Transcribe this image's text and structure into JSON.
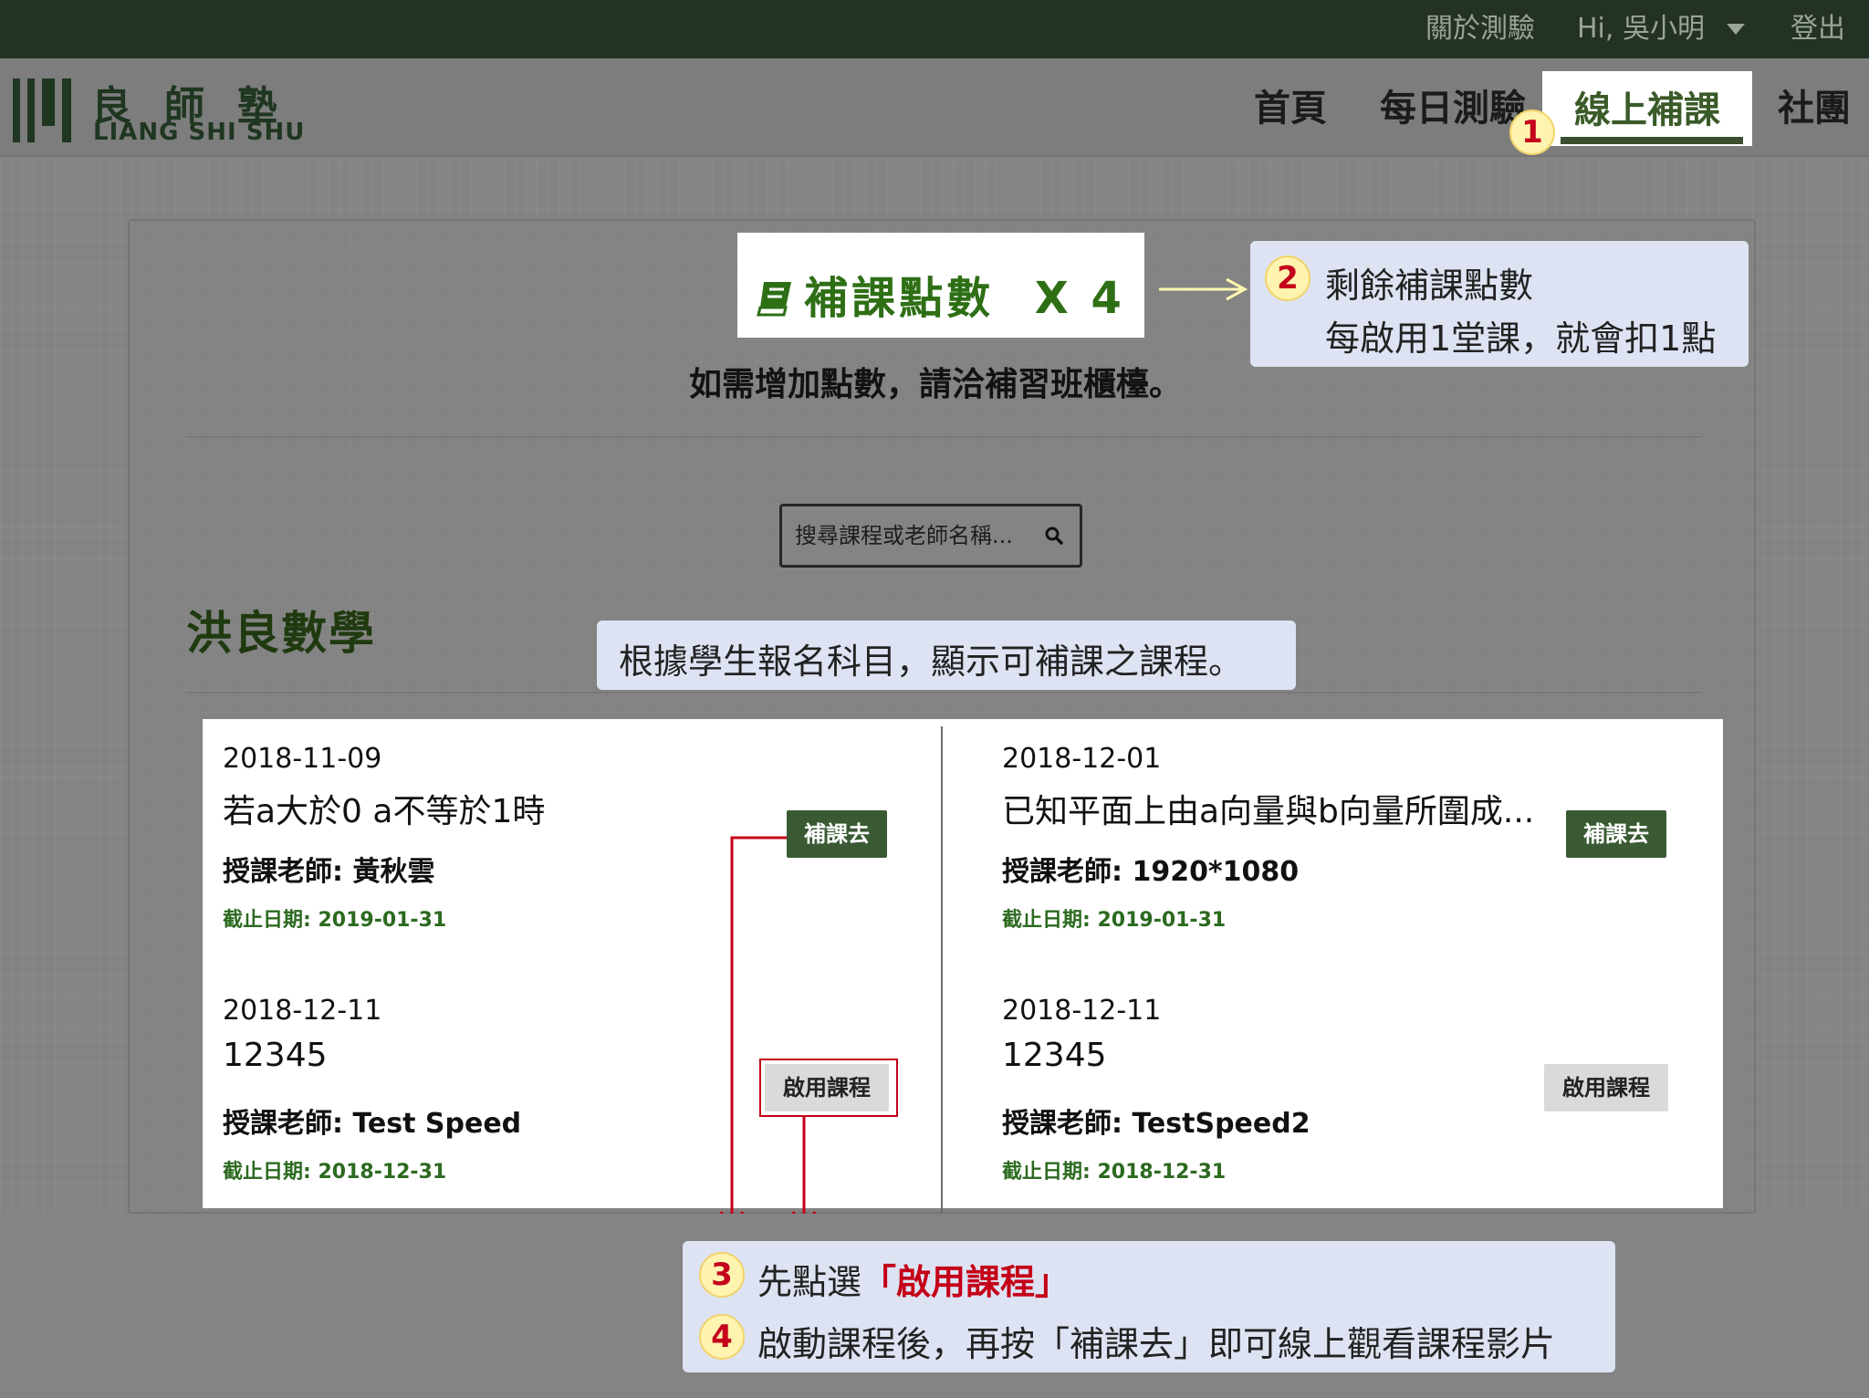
{
  "topbar": {
    "about": "關於測驗",
    "greeting": "Hi, 吳小明",
    "logout": "登出"
  },
  "logo": {
    "cn": "良師塾",
    "en": "LIANG SHI SHU"
  },
  "nav": {
    "home": "首頁",
    "daily": "每日測驗",
    "online": "線上補課",
    "community": "社團"
  },
  "points": {
    "label": "補課點數",
    "count": "X 4",
    "note": "如需增加點數，請洽補習班櫃檯。"
  },
  "search": {
    "placeholder": "搜尋課程或老師名稱..."
  },
  "subject": {
    "title": "洪良數學"
  },
  "courses": [
    {
      "date": "2018-11-09",
      "title": "若a大於0 a不等於1時",
      "teacher": "授課老師: 黃秋雲",
      "deadline": "截止日期: 2019-01-31",
      "button": "補課去"
    },
    {
      "date": "2018-12-01",
      "title": "已知平面上由a向量與b向量所圍成...",
      "teacher": "授課老師: 1920*1080",
      "deadline": "截止日期: 2019-01-31",
      "button": "補課去"
    },
    {
      "date": "2018-12-11",
      "title": "12345",
      "teacher": "授課老師: Test Speed",
      "deadline": "截止日期: 2018-12-31",
      "button": "啟用課程"
    },
    {
      "date": "2018-12-11",
      "title": "12345",
      "teacher": "授課老師: TestSpeed2",
      "deadline": "截止日期: 2018-12-31",
      "button": "啟用課程"
    }
  ],
  "annotations": {
    "badge1": "1",
    "badge2": "2",
    "badge3": "3",
    "badge4": "4",
    "note2_line1": "剩餘補課點數",
    "note2_line2": "每啟用1堂課，就會扣1點",
    "note_subject": "根據學生報名科目，顯示可補課之課程。",
    "note3_prefix": "先點選",
    "note3_emph": "「啟用課程」",
    "note4": "啟動課程後，再按「補課去」即可線上觀看課程影片"
  },
  "colors": {
    "topbar": "#233222",
    "brand_green": "#2e6f16",
    "go_button": "#3a5a34",
    "callout": "#dde3f2",
    "annotation_red": "#c40018",
    "badge_fill": "#fff3b0"
  }
}
